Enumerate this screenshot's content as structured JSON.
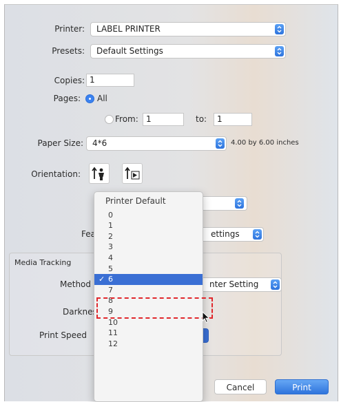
{
  "printer": {
    "label": "Printer:",
    "value": "LABEL PRINTER"
  },
  "presets": {
    "label": "Presets:",
    "value": "Default Settings"
  },
  "copies": {
    "label": "Copies:",
    "value": "1"
  },
  "pages": {
    "label": "Pages:",
    "all_label": "All",
    "from_label": "From:",
    "from_value": "1",
    "to_label": "to:",
    "to_value": "1",
    "selected": "All"
  },
  "paper_size": {
    "label": "Paper Size:",
    "value": "4*6",
    "dimensions": "4.00 by 6.00 inches"
  },
  "orientation": {
    "label": "Orientation:",
    "options": [
      "portrait-icon",
      "landscape-icon"
    ],
    "selected": "portrait"
  },
  "section_popup": {
    "partial_label": "Fea",
    "value": "ettings"
  },
  "group": {
    "title": "Media Tracking",
    "method_label": "Method",
    "method_value": "nter Setting",
    "darkness_label": "Darknes",
    "print_speed_label": "Print Speed"
  },
  "darkness_menu": {
    "items": [
      "Printer Default",
      "0",
      "1",
      "2",
      "3",
      "4",
      "5",
      "6",
      "7",
      "8",
      "9",
      "10",
      "11",
      "12"
    ],
    "selected": "6",
    "check_mark": "✓"
  },
  "buttons": {
    "cancel": "Cancel",
    "print": "Print"
  },
  "colors": {
    "accent": "#3a6fd4",
    "highlight_border": "#e0262b"
  }
}
